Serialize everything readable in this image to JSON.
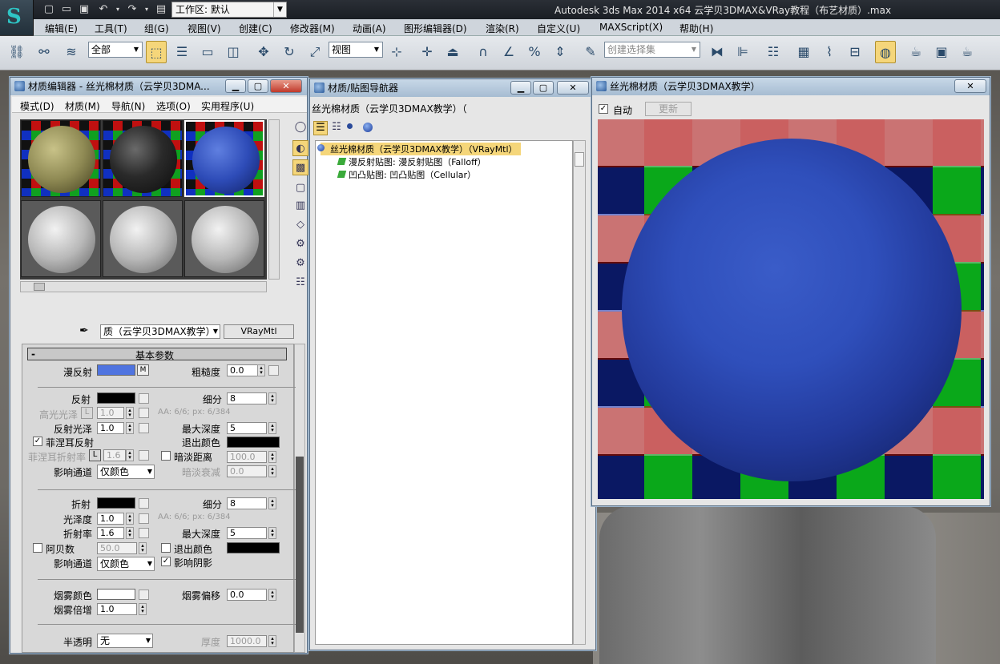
{
  "app": {
    "workspace_label": "工作区: 默认",
    "title": "Autodesk 3ds Max  2014 x64        云学贝3DMAX&VRay教程（布艺材质）.max"
  },
  "menubar": [
    "编辑(E)",
    "工具(T)",
    "组(G)",
    "视图(V)",
    "创建(C)",
    "修改器(M)",
    "动画(A)",
    "图形编辑器(D)",
    "渲染(R)",
    "自定义(U)",
    "MAXScript(X)",
    "帮助(H)"
  ],
  "toolbar": {
    "filter": "全部",
    "ref_coord": "视图",
    "selection_set_placeholder": "创建选择集"
  },
  "material_editor": {
    "title": "材质编辑器 - 丝光棉材质（云学贝3DMA...",
    "menu": [
      "模式(D)",
      "材质(M)",
      "导航(N)",
      "选项(O)",
      "实用程序(U)"
    ],
    "material_name": "质（云学贝3DMAX教学）",
    "material_type": "VRayMtl",
    "rollout_title": "基本参数",
    "params": {
      "diffuse": "漫反射",
      "diffuse_map": "M",
      "roughness": "粗糙度",
      "roughness_value": "0.0",
      "reflect": "反射",
      "subdivs": "细分",
      "refl_subdivs": "8",
      "hilight_gloss": "高光光泽",
      "hilight_lock": "L",
      "hilight_value": "1.0",
      "aa_info": "AA: 6/6; px: 6/384",
      "refl_gloss": "反射光泽",
      "refl_gloss_value": "1.0",
      "max_depth": "最大深度",
      "refl_max_depth": "5",
      "fresnel": "菲涅耳反射",
      "exit_color": "退出颜色",
      "fresnel_ior": "菲涅耳折射率",
      "fresnel_lock": "L",
      "fresnel_ior_value": "1.6",
      "dim_distance": "暗淡距离",
      "dim_distance_value": "100.0",
      "affect_channels": "影响通道",
      "affect_value": "仅颜色",
      "dim_falloff": "暗淡衰减",
      "dim_falloff_value": "0.0",
      "refract": "折射",
      "refr_subdivs": "8",
      "glossiness": "光泽度",
      "refr_gloss_value": "1.0",
      "ior": "折射率",
      "ior_value": "1.6",
      "refr_max_depth": "5",
      "abbe": "阿贝数",
      "abbe_value": "50.0",
      "refr_exit_color": "退出颜色",
      "refr_affect_channels": "影响通道",
      "refr_affect_value": "仅颜色",
      "affect_shadows": "影响阴影",
      "fog_color": "烟雾颜色",
      "fog_bias": "烟雾偏移",
      "fog_bias_value": "0.0",
      "fog_mult": "烟雾倍增",
      "fog_mult_value": "1.0",
      "translucency": "半透明",
      "translucency_value": "无",
      "thickness": "厚度",
      "thickness_value": "1000.0"
    },
    "colors": {
      "diffuse": "#4f74e0",
      "reflect": "#000000",
      "refract": "#000000",
      "fog": "#ffffff"
    }
  },
  "navigator": {
    "title": "材质/贴图导航器",
    "path_label": "丝光棉材质（云学贝3DMAX教学）（",
    "tree": [
      "丝光棉材质（云学贝3DMAX教学）（VRayMtl）",
      "漫反射贴图: 漫反射贴图（Falloff）",
      "凹凸贴图: 凹凸贴图（Cellular）"
    ]
  },
  "render_window": {
    "title": "丝光棉材质（云学贝3DMAX教学）",
    "auto_label": "自动",
    "update_label": "更新"
  }
}
